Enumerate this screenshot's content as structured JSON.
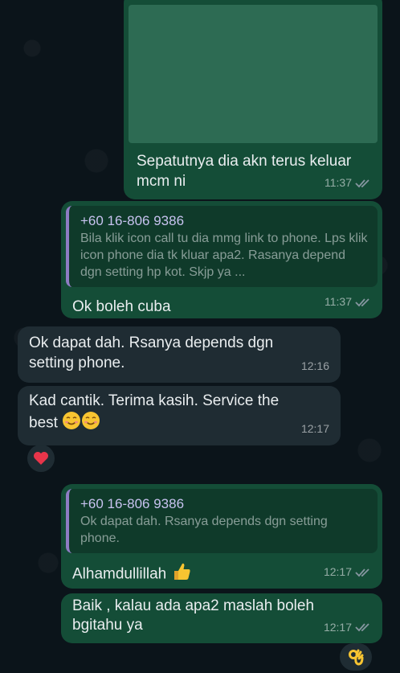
{
  "messages": [
    {
      "type": "outgoing",
      "has_image": true,
      "text": "Sepatutnya dia akn terus keluar mcm ni",
      "time": "11:37",
      "status": "read"
    },
    {
      "type": "outgoing",
      "quote": {
        "author": "+60 16-806 9386",
        "text": "Bila klik icon call tu dia mmg link to phone. Lps klik icon phone dia tk kluar apa2. Rasanya depend dgn setting hp kot. Skjp ya ..."
      },
      "text": "Ok boleh cuba",
      "time": "11:37",
      "status": "read"
    },
    {
      "type": "incoming",
      "text": "Ok dapat dah. Rsanya depends dgn setting phone.",
      "time": "12:16"
    },
    {
      "type": "incoming",
      "text": "Kad cantik. Terima kasih. Service the best",
      "emoji": "smiling-face-emoji x2",
      "time": "12:17",
      "reaction": "heart"
    },
    {
      "type": "outgoing",
      "quote": {
        "author": "+60 16-806 9386",
        "text": "Ok dapat dah. Rsanya depends dgn setting phone."
      },
      "text": "Alhamdullillah",
      "emoji": "thumbs-up-emoji",
      "time": "12:17",
      "status": "read"
    },
    {
      "type": "outgoing",
      "text": "Baik , kalau ada apa2 maslah boleh bgitahu ya",
      "time": "12:17",
      "status": "read",
      "reaction": "ok-hand"
    }
  ],
  "colors": {
    "background": "#0b141a",
    "outgoing_bubble": "#144d37",
    "incoming_bubble": "#1f2c33",
    "quote_author": "#c8c3f0",
    "read_ticks": "#8696a0"
  }
}
